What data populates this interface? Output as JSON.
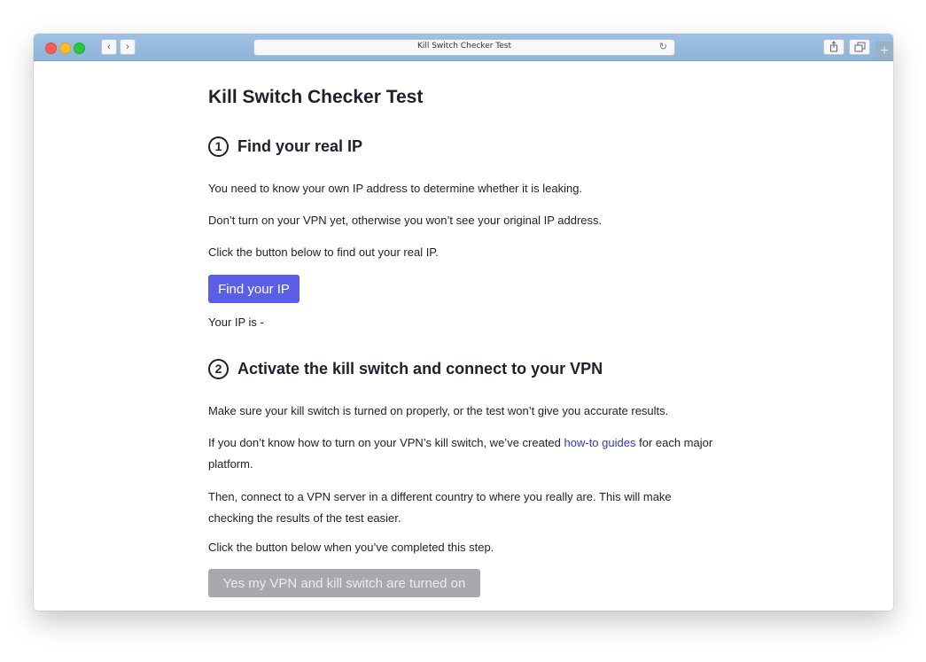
{
  "browser": {
    "url_title": "Kill Switch Checker Test",
    "back_glyph": "‹",
    "forward_glyph": "›",
    "reload_glyph": "↻",
    "new_tab_glyph": "+"
  },
  "page": {
    "title": "Kill Switch Checker Test",
    "step1": {
      "number": "1",
      "heading": "Find your real IP",
      "para1": "You need to know your own IP address to determine whether it is leaking.",
      "para2": "Don’t turn on your VPN yet, otherwise you won’t see your original IP address.",
      "para3": "Click the button below to find out your real IP.",
      "button_label": "Find your IP",
      "ip_result": "Your IP is -"
    },
    "step2": {
      "number": "2",
      "heading": "Activate the kill switch and connect to your VPN",
      "para1": "Make sure your kill switch is turned on properly, or the test won’t give you accurate results.",
      "para2_before": "If you don’t know how to turn on your VPN’s kill switch, we’ve created ",
      "para2_link": "how-to guides",
      "para2_after": " for each major platform.",
      "para3": "Then, connect to a VPN server in a different country to where you really are. This will make checking the results of the test easier.",
      "para4": "Click the button below when you’ve completed this step.",
      "button_label": "Yes my VPN and kill switch are turned on"
    }
  },
  "colors": {
    "primary_button": "#5a5fe6",
    "disabled_button": "#a9a9ad",
    "link": "#2f3ab5",
    "titlebar": "#9fc1e3"
  }
}
